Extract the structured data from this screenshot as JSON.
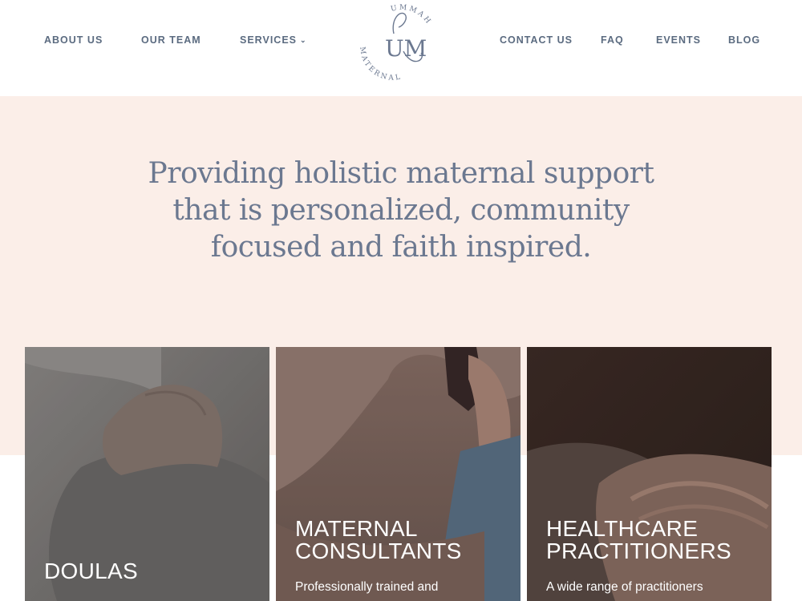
{
  "nav": {
    "about": "ABOUT US",
    "team": "OUR TEAM",
    "services": "SERVICES",
    "contact": "CONTACT US",
    "faq": "FAQ",
    "events": "EVENTS",
    "blog": "BLOG"
  },
  "logo": {
    "monogram": "UM",
    "top_text": "UMMAH",
    "bottom_text": "MATERNAL"
  },
  "hero": {
    "line1": "Providing holistic maternal support",
    "line2": "that is personalized, community",
    "line3": "focused and faith inspired."
  },
  "cards": [
    {
      "title_line1": "DOULAS",
      "title_line2": "",
      "desc": ""
    },
    {
      "title_line1": "MATERNAL",
      "title_line2": "CONSULTANTS",
      "desc": "Professionally trained and"
    },
    {
      "title_line1": "HEALTHCARE",
      "title_line2": "PRACTITIONERS",
      "desc": "A wide range of practitioners"
    }
  ],
  "colors": {
    "nav_text": "#5b6b80",
    "hero_bg": "#fbeee8",
    "hero_text": "#6b7890",
    "logo": "#6b7890"
  }
}
